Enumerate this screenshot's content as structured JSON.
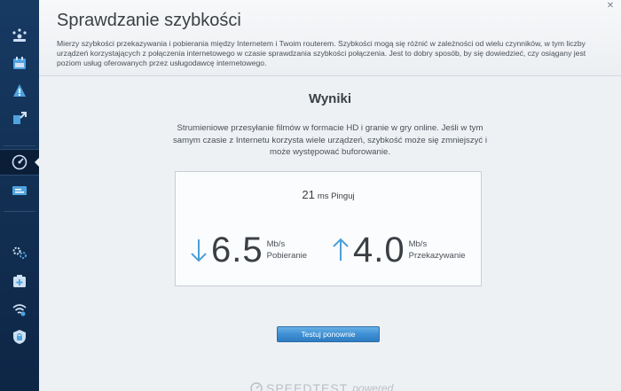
{
  "header": {
    "title": "Sprawdzanie szybkości",
    "description": "Mierzy szybkości przekazywania i pobierania między Internetem i Twoim routerem. Szybkości mogą się różnić w zależności od wielu czynników, w tym liczby urządzeń korzystających z połączenia internetowego w czasie sprawdzania szybkości połączenia. Jest to dobry sposób, by się dowiedzieć, czy osiągany jest poziom usług oferowanych przez usługodawcę internetowego."
  },
  "sidebar": {
    "items": [
      {
        "icon": "network-map-icon"
      },
      {
        "icon": "guest-access-icon"
      },
      {
        "icon": "parental-controls-icon"
      },
      {
        "icon": "media-prioritization-icon"
      },
      {
        "icon": "speed-test-icon",
        "active": true
      },
      {
        "icon": "external-storage-icon"
      },
      {
        "icon": "connectivity-icon"
      },
      {
        "icon": "troubleshooting-icon"
      },
      {
        "icon": "wireless-icon"
      },
      {
        "icon": "security-icon"
      }
    ]
  },
  "results": {
    "title": "Wyniki",
    "description": "Strumieniowe przesyłanie filmów w formacie HD i granie w gry online. Jeśli w tym samym czasie z Internetu korzysta wiele urządzeń, szybkość może się zmniejszyć i może występować buforowanie.",
    "ping_value": "21",
    "ping_unit": "ms Pinguj",
    "download": {
      "value": "6.5",
      "unit": "Mb/s",
      "label": "Pobieranie"
    },
    "upload": {
      "value": "4.0",
      "unit": "Mb/s",
      "label": "Przekazywanie"
    }
  },
  "actions": {
    "retest_label": "Testuj ponownie"
  },
  "footer": {
    "logo_text": "SPEEDTEST",
    "logo_suffix": "powered"
  },
  "colors": {
    "accent": "#3e8fd3",
    "arrow": "#4a9fd8",
    "sidebar": "#173a63"
  }
}
